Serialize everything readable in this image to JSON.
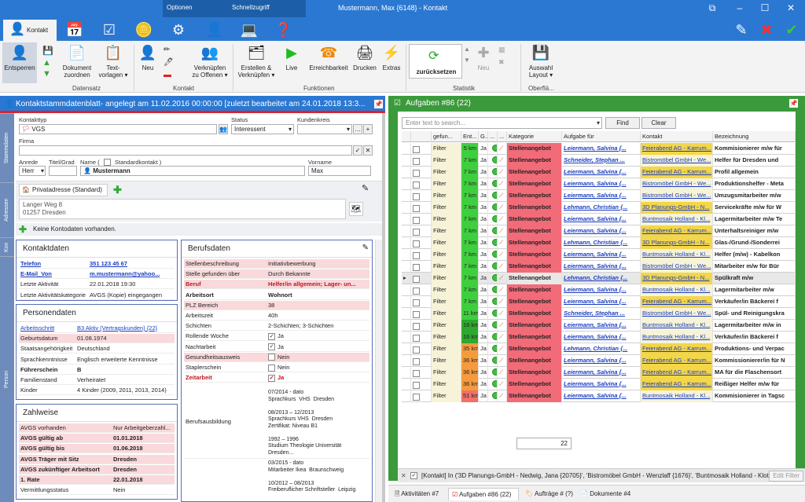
{
  "window": {
    "title": "Mustermann, Max {6148} - Kontakt"
  },
  "context_tabs": {
    "optionen": "Optionen",
    "schnellzugriff": "Schnellzugriff"
  },
  "ribbon": {
    "tab_kontakt": "Kontakt",
    "buttons": {
      "entsperren": "Entsperren",
      "dokument": "Dokument\nzuordnen",
      "textvorlagen": "Text-\nvorlagen ▾",
      "neu": "Neu",
      "verknuepfen": "Verknüpfen\nzu Offenen ▾",
      "erstellen": "Erstellen &\nVerknüpfen ▾",
      "live": "Live",
      "erreichbarkeit": "Erreichbarkeit",
      "drucken": "Drucken",
      "extras": "Extras",
      "zuruecksetzen": "zurücksetzen",
      "neu2": "Neu",
      "auswahl": "Auswahl\nLayout ▾"
    },
    "groups": {
      "datensatz": "Datensatz",
      "kontakt": "Kontakt",
      "funktionen": "Funktionen",
      "statistik": "Statistik",
      "oberflaeche": "Oberflä..."
    }
  },
  "left": {
    "header": "Kontaktstammdatenblatt- angelegt am 11.02.2016 00:00:00 [zuletzt bearbeitet am 24.01.2018 13:3...",
    "vtabs": [
      "Stammdaten",
      "Adressen",
      "Kon",
      "Person"
    ],
    "form": {
      "kontakttyp_label": "Kontakttyp",
      "kontakttyp": "VGS",
      "status_label": "Status",
      "status": "Interessent",
      "kundenkreis_label": "Kundenkreis",
      "firma_label": "Firma",
      "anrede_label": "Anrede",
      "anrede": "Herr",
      "titel_label": "Titel/Grad",
      "name_label": "Name (",
      "standard_label": "Standardkontakt )",
      "name": "Mustermann",
      "vorname_label": "Vorname",
      "vorname": "Max"
    },
    "address": {
      "tab": "Privatadresse (Standard)",
      "line1": "Langer Weg 8",
      "line2": "01257 Dresden"
    },
    "kontodaten": "Keine Kontodaten vorhanden.",
    "kontaktdaten": {
      "title": "Kontaktdaten",
      "rows": [
        {
          "k": "Telefon",
          "v": "351 123 45 67"
        },
        {
          "k": "E-Mail_Von",
          "v": "m.mustermann@yahoo..."
        },
        {
          "k": "Letzte Aktivität",
          "v": "22.01.2018 19:30"
        },
        {
          "k": "Letzte Aktivitätskategorie",
          "v": "AVGS (Kopie) eingegangen"
        }
      ]
    },
    "personendaten": {
      "title": "Personendaten",
      "rows": [
        {
          "k": "Arbeitsschritt",
          "v": "B3 Aktiv (Vertragskunden) {22}"
        },
        {
          "k": "Geburtsdatum",
          "v": "01.08.1974"
        },
        {
          "k": "Staatsangehörigkeit",
          "v": "Deutschland"
        },
        {
          "k": "Sprachkenntnisse",
          "v": "Englisch erweiterte Kenntnisse"
        },
        {
          "k": "Führerschein",
          "v": "B"
        },
        {
          "k": "Familienstand",
          "v": "Verheiratet"
        },
        {
          "k": "Kinder",
          "v": "4 Kinder (2009, 2011, 2013, 2014)"
        }
      ]
    },
    "zahlweise": {
      "title": "Zahlweise",
      "rows": [
        {
          "k": "AVGS vorhanden",
          "v": "Nur Arbeitgeberzahl..."
        },
        {
          "k": "AVGS gültig ab",
          "v": "01.01.2018"
        },
        {
          "k": "AVGS gültig bis",
          "v": "01.06.2018"
        },
        {
          "k": "AVGS Träger mit Sitz",
          "v": "Dresden"
        },
        {
          "k": "AVGS zukünftiger Arbeitsort",
          "v": "Dresden"
        },
        {
          "k": "1. Rate",
          "v": "22.01.2018"
        },
        {
          "k": "Vermittlungsstatus",
          "v": "Nein"
        }
      ]
    },
    "berufsdaten": {
      "title": "Berufsdaten",
      "rows": [
        {
          "k": "Stellenbeschreibung",
          "v": "Initiativbewerbung"
        },
        {
          "k": "Stelle gefunden über",
          "v": "Durch Bekannte"
        },
        {
          "k": "Beruf",
          "v": "Helfer/in allgemein; Lager- un..."
        },
        {
          "k": "Arbeitsort",
          "v": "Wohnort"
        },
        {
          "k": "PLZ Bereich",
          "v": "38"
        },
        {
          "k": "Arbeitszeit",
          "v": "40h"
        },
        {
          "k": "Schichten",
          "v": "2-Schichten; 3-Schichten"
        },
        {
          "k": "Rollende Woche",
          "v": "Ja"
        },
        {
          "k": "Nachtarbeit",
          "v": "Ja"
        },
        {
          "k": "Gesundheitsausweis",
          "v": "Nein"
        },
        {
          "k": "Staplerschein",
          "v": "Nein"
        },
        {
          "k": "Zeitarbeit",
          "v": "Ja"
        }
      ],
      "ausbildung_label": "Berufsausbildung",
      "ausbildung": "07/2014 - dato\nSprachkurs  VHS  Dresden\n\n08/2013 – 12/2013\nSprachkurs VHS  Dresden\nZertifikat: Niveau B1\n\n1992 – 1996\nStudium Theologie Universität\nDresden...",
      "extra_label": "",
      "extra": "03/2015 - dato\nMitarbeiter Ikea  Braunschweig\n\n10/2012 – 08/2013\nFreiberuflicher Schriftsteller  Leipzig"
    }
  },
  "right": {
    "header": "Aufgaben #86 (22)",
    "search_placeholder": "Enter text to search...",
    "find": "Find",
    "clear": "Clear",
    "columns": [
      "gefun...",
      "Ent...",
      "G...",
      "...",
      "...",
      "Kategorie",
      "Aufgabe für",
      "Kontakt",
      "Bezeichnung"
    ],
    "rows": [
      {
        "f": "Filter",
        "e": "5 km",
        "g": "Ja",
        "kat": "Stellenangebot",
        "af": "Leiermann, Salvina {...",
        "kon": "Feierabend AG - Karrum...",
        "bez": "Kommisionierer m/w für"
      },
      {
        "f": "Filter",
        "e": "7 km",
        "g": "Ja",
        "kat": "Stellenangebot",
        "af": "Schneider, Stephan ...",
        "kon": "Bistromöbel GmbH - We...",
        "bez": "Helfer für Dresden und"
      },
      {
        "f": "Filter",
        "e": "7 km",
        "g": "Ja",
        "kat": "Stellenangebot",
        "af": "Leiermann, Salvina {...",
        "kon": "Feierabend AG - Karrum...",
        "bez": "Profil allgemein"
      },
      {
        "f": "Filter",
        "e": "7 km",
        "g": "Ja",
        "kat": "Stellenangebot",
        "af": "Leiermann, Salvina {...",
        "kon": "Bistromöbel GmbH - We...",
        "bez": "Produktionshelfer - Meta"
      },
      {
        "f": "Filter",
        "e": "7 km",
        "g": "Ja",
        "kat": "Stellenangebot",
        "af": "Leiermann, Salvina {...",
        "kon": "Bistromöbel GmbH - We...",
        "bez": "Umzugsmitarbeiter m/w"
      },
      {
        "f": "Filter",
        "e": "7 km",
        "g": "Ja",
        "kat": "Stellenangebot",
        "af": "Lehmann, Christian {...",
        "kon": "3D Planungs-GmbH - N...",
        "bez": "Servicekräfte m/w für W"
      },
      {
        "f": "Filter",
        "e": "7 km",
        "g": "Ja",
        "kat": "Stellenangebot",
        "af": "Leiermann, Salvina {...",
        "kon": "Buntmosaik Holland - Kl...",
        "bez": "Lagermitarbeiter m/w Te"
      },
      {
        "f": "Filter",
        "e": "7 km",
        "g": "Ja",
        "kat": "Stellenangebot",
        "af": "Leiermann, Salvina {...",
        "kon": "Feierabend AG - Karrum...",
        "bez": "Unterhaltsreiniger m/w"
      },
      {
        "f": "Filter",
        "e": "7 km",
        "g": "Ja",
        "kat": "Stellenangebot",
        "af": "Lehmann, Christian {...",
        "kon": "3D Planungs-GmbH - N...",
        "bez": "Glas-/Grund-/Sonderrei"
      },
      {
        "f": "Filter",
        "e": "7 km",
        "g": "Ja",
        "kat": "Stellenangebot",
        "af": "Leiermann, Salvina {...",
        "kon": "Buntmosaik Holland - Kl...",
        "bez": "Helfer (m/w) - Kabelkon"
      },
      {
        "f": "Filter",
        "e": "7 km",
        "g": "Ja",
        "kat": "Stellenangebot",
        "af": "Leiermann, Salvina {...",
        "kon": "Bistromöbel GmbH - We...",
        "bez": "Mitarbeiter m/w für Bür"
      },
      {
        "f": "Filter",
        "e": "7 km",
        "g": "Ja",
        "kat": "Stellenangebot",
        "af": "Lehmann, Christian {...",
        "kon": "3D Planungs-GmbH - N...",
        "bez": "Spülkraft m/w"
      },
      {
        "f": "Filter",
        "e": "7 km",
        "g": "Ja",
        "kat": "Stellenangebot",
        "af": "Leiermann, Salvina {...",
        "kon": "Buntmosaik Holland - Kl...",
        "bez": "Lagermitarbeiter m/w"
      },
      {
        "f": "Filter",
        "e": "7 km",
        "g": "Ja",
        "kat": "Stellenangebot",
        "af": "Leiermann, Salvina {...",
        "kon": "Feierabend AG - Karrum...",
        "bez": "Verkäufer/in  Bäckerei f"
      },
      {
        "f": "Filter",
        "e": "11 km",
        "g": "Ja",
        "kat": "Stellenangebot",
        "af": "Schneider, Stephan ...",
        "kon": "Bistromöbel GmbH - We...",
        "bez": "Spül- und Reinigungskra"
      },
      {
        "f": "Filter",
        "e": "16 km",
        "g": "Ja",
        "kat": "Stellenangebot",
        "af": "Leiermann, Salvina {...",
        "kon": "Buntmosaik Holland - Kl...",
        "bez": "Lagermitarbeiter m/w in"
      },
      {
        "f": "Filter",
        "e": "16 km",
        "g": "Ja",
        "kat": "Stellenangebot",
        "af": "Leiermann, Salvina {...",
        "kon": "Buntmosaik Holland - Kl...",
        "bez": "Verkäufer/in  Bäckerei f"
      },
      {
        "f": "Filter",
        "e": "35 km",
        "g": "Ja",
        "kat": "Stellenangebot",
        "af": "Lehmann, Christian {...",
        "kon": "Feierabend AG - Karrum...",
        "bez": "Produktions- und Verpac"
      },
      {
        "f": "Filter",
        "e": "36 km",
        "g": "Ja",
        "kat": "Stellenangebot",
        "af": "Leiermann, Salvina {...",
        "kon": "Feierabend AG - Karrum...",
        "bez": "Kommissionierer/in für N"
      },
      {
        "f": "Filter",
        "e": "36 km",
        "g": "Ja",
        "kat": "Stellenangebot",
        "af": "Leiermann, Salvina {...",
        "kon": "Feierabend AG - Karrum...",
        "bez": "MA für die Flaschensort"
      },
      {
        "f": "Filter",
        "e": "36 km",
        "g": "Ja",
        "kat": "Stellenangebot",
        "af": "Leiermann, Salvina {...",
        "kon": "Feierabend AG - Karrum...",
        "bez": "Reißiger Helfer m/w für"
      },
      {
        "f": "Filter",
        "e": "51 km",
        "g": "Ja",
        "kat": "Stellenangebot",
        "af": "Leiermann, Salvina {...",
        "kon": "Buntmosaik Holland - Kl...",
        "bez": "Kommisionierer in Tagsc"
      }
    ],
    "count": "22",
    "filter_text": "[Kontakt] In ('3D Planungs-GmbH - Nedwig, Jana {20705}', 'Bistromöbel GmbH - Wenzlaff {1676}', 'Buntmosaik Holland - Klotzs...",
    "edit_filter": "Edit Filter",
    "bottom_tabs": [
      "Aktivitäten #7",
      "Aufgaben #86 (22)",
      "Aufträge # (?)",
      "Dokumente #4"
    ]
  },
  "colors": {
    "blue": "#2b78d2",
    "green": "#3b9a3b",
    "red_header": "#d9232d"
  }
}
